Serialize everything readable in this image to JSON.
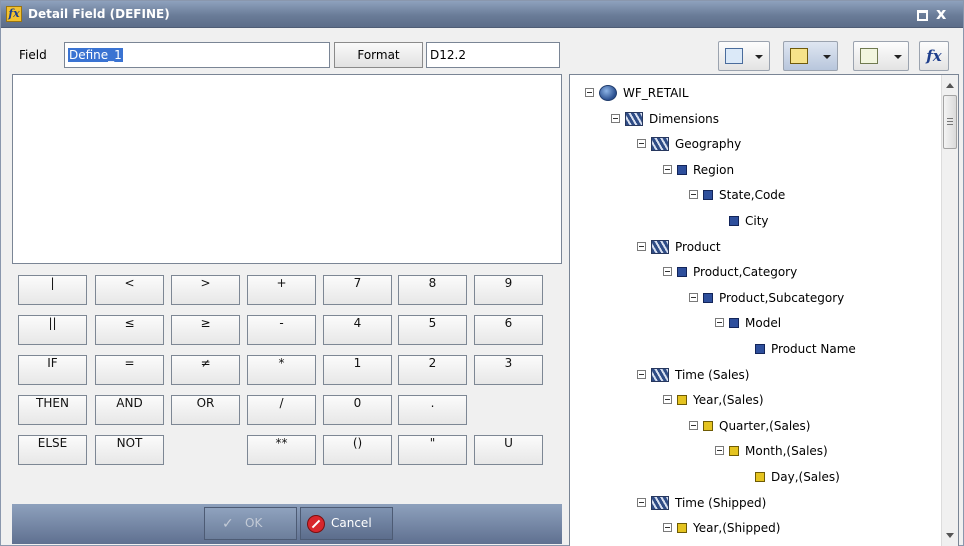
{
  "window": {
    "title": "Detail Field (DEFINE)",
    "title_icon": "fx-icon",
    "controls": {
      "maximize": "maximize-icon",
      "close_label": "x"
    }
  },
  "field": {
    "label": "Field",
    "value": "Define_1",
    "format_button": "Format",
    "format_value": "D12.2"
  },
  "toolbar": {
    "buttons": [
      {
        "icon": "picture-icon"
      },
      {
        "icon": "tree-view-icon"
      },
      {
        "icon": "list-view-icon"
      },
      {
        "icon": "fx-icon"
      }
    ]
  },
  "expression": {
    "text": ""
  },
  "keypad": {
    "rows": [
      [
        "|",
        "<",
        ">",
        "+",
        "7",
        "8",
        "9"
      ],
      [
        "||",
        "≤",
        "≥",
        "-",
        "4",
        "5",
        "6"
      ],
      [
        "IF",
        "=",
        "≠",
        "*",
        "1",
        "2",
        "3"
      ],
      [
        "THEN",
        "AND",
        "OR",
        "/",
        "0",
        ".",
        ""
      ],
      [
        "ELSE",
        "NOT",
        "",
        "**",
        "()",
        "\"",
        "U"
      ]
    ]
  },
  "actions": {
    "ok_label": "OK",
    "cancel_label": "Cancel"
  },
  "tree": {
    "nodes": [
      {
        "label": "WF_RETAIL",
        "icon": "database-icon",
        "expanded": true
      },
      {
        "label": "Dimensions",
        "icon": "dimension-folder-icon",
        "expanded": true
      },
      {
        "label": "Geography",
        "icon": "dimension-icon",
        "expanded": true
      },
      {
        "label": "Region",
        "icon": "level-icon",
        "expanded": true
      },
      {
        "label": "State,Code",
        "icon": "level-icon",
        "expanded": true
      },
      {
        "label": "City",
        "icon": "level-icon",
        "expanded": false
      },
      {
        "label": "Product",
        "icon": "dimension-icon",
        "expanded": true
      },
      {
        "label": "Product,Category",
        "icon": "level-icon",
        "expanded": true
      },
      {
        "label": "Product,Subcategory",
        "icon": "level-icon",
        "expanded": true
      },
      {
        "label": "Model",
        "icon": "level-icon",
        "expanded": true
      },
      {
        "label": "Product Name",
        "icon": "level-icon",
        "expanded": false
      },
      {
        "label": "Time (Sales)",
        "icon": "dimension-icon",
        "expanded": true
      },
      {
        "label": "Year,(Sales)",
        "icon": "time-level-icon",
        "expanded": true
      },
      {
        "label": "Quarter,(Sales)",
        "icon": "time-level-icon",
        "expanded": true
      },
      {
        "label": "Month,(Sales)",
        "icon": "time-level-icon",
        "expanded": true
      },
      {
        "label": "Day,(Sales)",
        "icon": "time-level-icon",
        "expanded": false
      },
      {
        "label": "Time (Shipped)",
        "icon": "dimension-icon",
        "expanded": true
      },
      {
        "label": "Year,(Shipped)",
        "icon": "time-level-icon",
        "expanded": true
      }
    ]
  },
  "colors": {
    "title_bar": "#6a7c98",
    "selection": "#3a73d2",
    "level_icon": "#2e4f9c",
    "time_level_icon": "#e4c320"
  }
}
